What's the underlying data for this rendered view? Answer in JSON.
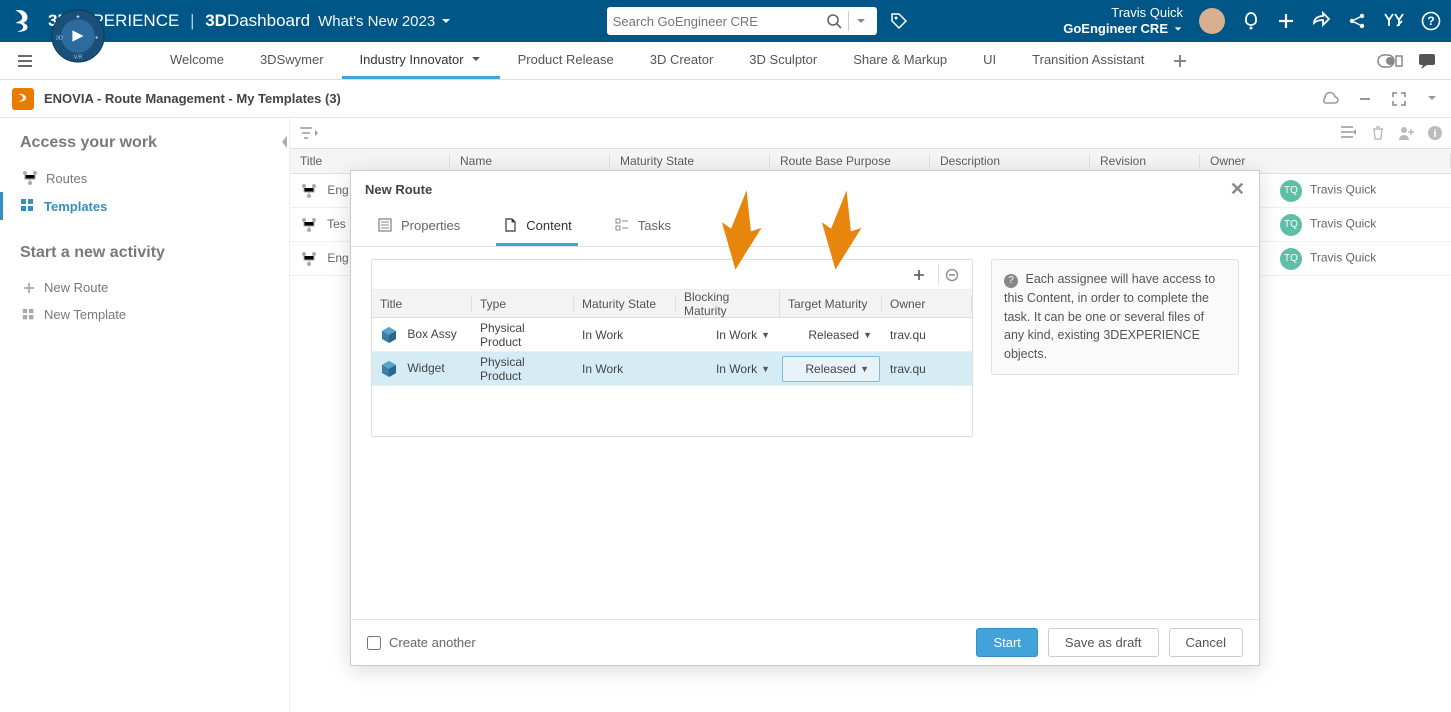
{
  "header": {
    "brand_prefix_bold": "3D",
    "brand_prefix_rest": "EXPERIENCE",
    "brand_suffix_bold": "3D",
    "brand_suffix_rest": "Dashboard",
    "whatsnew": "What's New 2023",
    "search_placeholder": "Search GoEngineer CRE",
    "user_name": "Travis Quick",
    "user_org": "GoEngineer CRE"
  },
  "nav_tabs": [
    "Welcome",
    "3DSwymer",
    "Industry Innovator",
    "Product Release",
    "3D Creator",
    "3D Sculptor",
    "Share & Markup",
    "UI",
    "Transition Assistant"
  ],
  "nav_active_index": 2,
  "app_title": "ENOVIA - Route Management - My Templates (3)",
  "sidebar": {
    "section1_title": "Access your work",
    "items1": [
      {
        "label": "Routes",
        "active": false
      },
      {
        "label": "Templates",
        "active": true
      }
    ],
    "section2_title": "Start a new activity",
    "items2": [
      {
        "label": "New Route"
      },
      {
        "label": "New Template"
      }
    ]
  },
  "bg_table": {
    "columns": [
      "Title",
      "Name",
      "Maturity State",
      "Route Base Purpose",
      "Description",
      "Revision",
      "Owner"
    ],
    "rows": [
      {
        "title": "Eng",
        "owner": "Travis Quick"
      },
      {
        "title": "Tes",
        "owner": "Travis Quick"
      },
      {
        "title": "Eng",
        "owner": "Travis Quick"
      }
    ],
    "owner_initials": "TQ"
  },
  "modal": {
    "title": "New Route",
    "tabs": [
      "Properties",
      "Content",
      "Tasks"
    ],
    "active_tab_index": 1,
    "content_columns": [
      "Title",
      "Type",
      "Maturity State",
      "Blocking Maturity",
      "Target Maturity",
      "Owner"
    ],
    "content_rows": [
      {
        "title": "Box Assy",
        "type": "Physical Product",
        "maturity": "In Work",
        "blocking": "In Work",
        "target": "Released",
        "owner": "trav.qu"
      },
      {
        "title": "Widget",
        "type": "Physical Product",
        "maturity": "In Work",
        "blocking": "In Work",
        "target": "Released",
        "owner": "trav.qu"
      }
    ],
    "info_text": "Each assignee will have access to this Content, in order to complete the task. It can be one or several files of any kind, existing 3DEXPERIENCE objects.",
    "create_another": "Create another",
    "btn_start": "Start",
    "btn_save": "Save as draft",
    "btn_cancel": "Cancel"
  }
}
